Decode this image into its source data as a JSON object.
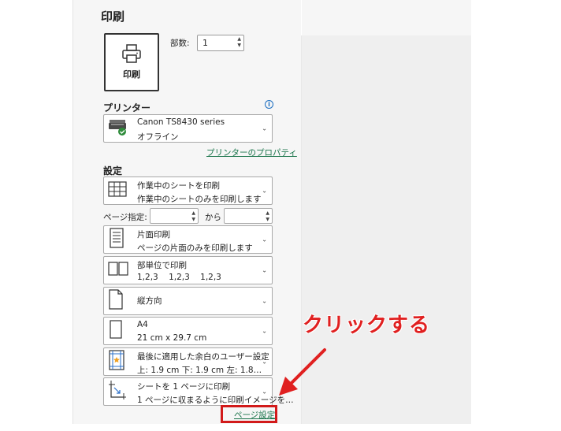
{
  "title": "印刷",
  "print_button": {
    "label": "印刷"
  },
  "copies": {
    "label": "部数:",
    "value": "1"
  },
  "printer": {
    "section_title": "プリンター",
    "name": "Canon TS8430 series",
    "status": "オフライン",
    "properties_link": "プリンターのプロパティ"
  },
  "settings": {
    "section_title": "設定",
    "scope": {
      "line1": "作業中のシートを印刷",
      "line2": "作業中のシートのみを印刷します"
    },
    "pages": {
      "label": "ページ指定:",
      "from": "",
      "to_label": "から",
      "to": ""
    },
    "sides": {
      "line1": "片面印刷",
      "line2": "ページの片面のみを印刷します"
    },
    "collate": {
      "line1": "部単位で印刷",
      "line2": "1,2,3    1,2,3    1,2,3"
    },
    "orientation": {
      "line1": "縦方向"
    },
    "paper": {
      "line1": "A4",
      "line2": "21 cm x 29.7 cm"
    },
    "margins": {
      "line1": "最後に適用した余白のユーザー設定",
      "line2": "上: 1.9 cm 下: 1.9 cm 左: 1.8…"
    },
    "scaling": {
      "line1": "シートを 1 ページに印刷",
      "line2": "1 ページに収まるように印刷イメージを…"
    },
    "page_setup_link": "ページ設定"
  },
  "annotation": {
    "text": "クリックする",
    "color": "#e02020"
  },
  "colors": {
    "link": "#19744a",
    "highlight": "#d21a1a",
    "info": "#1c6ec0"
  }
}
